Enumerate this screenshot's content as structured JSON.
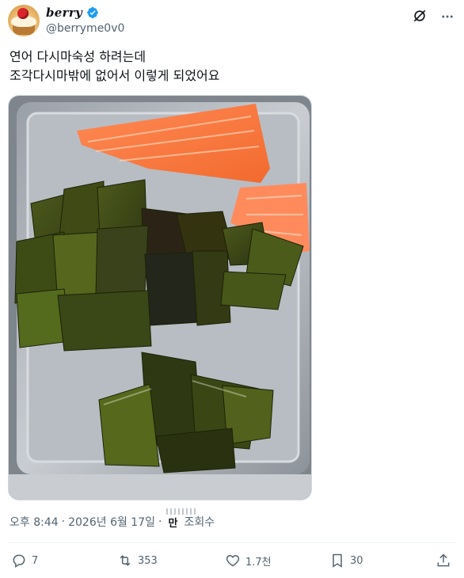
{
  "author": {
    "display_name": "berry",
    "handle": "@berryme0v0",
    "verified": true
  },
  "tweet": {
    "lines": [
      "연어 다시마숙성 하려는데",
      "조각다시마밖에 없어서 이렇게 되었어요"
    ]
  },
  "media": {
    "description_icon": "photo"
  },
  "meta": {
    "time": "오후 8:44",
    "separator": "·",
    "date": "2026년 6월 17일",
    "views_num": "만",
    "views_label": "조회수"
  },
  "actions": {
    "replies": "7",
    "reposts": "353",
    "likes": "1.7천",
    "bookmarks": "30"
  },
  "colors": {
    "text": "#0f1419",
    "muted": "#536471",
    "verified": "#1d9bf0",
    "divider": "#eff3f4"
  },
  "icons": [
    "grok-icon",
    "more-icon",
    "verified-icon",
    "reply-icon",
    "repost-icon",
    "like-icon",
    "bookmark-icon",
    "share-icon"
  ]
}
